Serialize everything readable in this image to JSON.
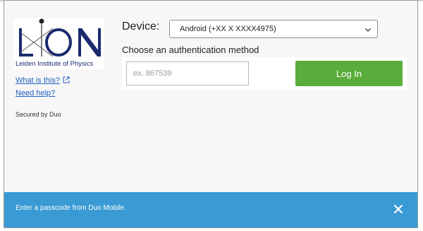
{
  "logo": {
    "caption": "Leiden Institute of Physics",
    "wordmark": "LION",
    "brand_color": "#1b2a6e"
  },
  "links": {
    "what_is_this": "What is this?",
    "need_help": "Need help?"
  },
  "secured_by": "Secured by Duo",
  "device": {
    "label": "Device:",
    "selected": "Android (+XX X XXXX4975)"
  },
  "auth": {
    "choose_label": "Choose an authentication method",
    "passcode_placeholder": "ex. 867539",
    "login_label": "Log In",
    "login_color": "#5aac3b"
  },
  "banner": {
    "message": "Enter a passcode from Duo Mobile.",
    "color": "#3a9ad3",
    "close_icon": "close-icon"
  }
}
